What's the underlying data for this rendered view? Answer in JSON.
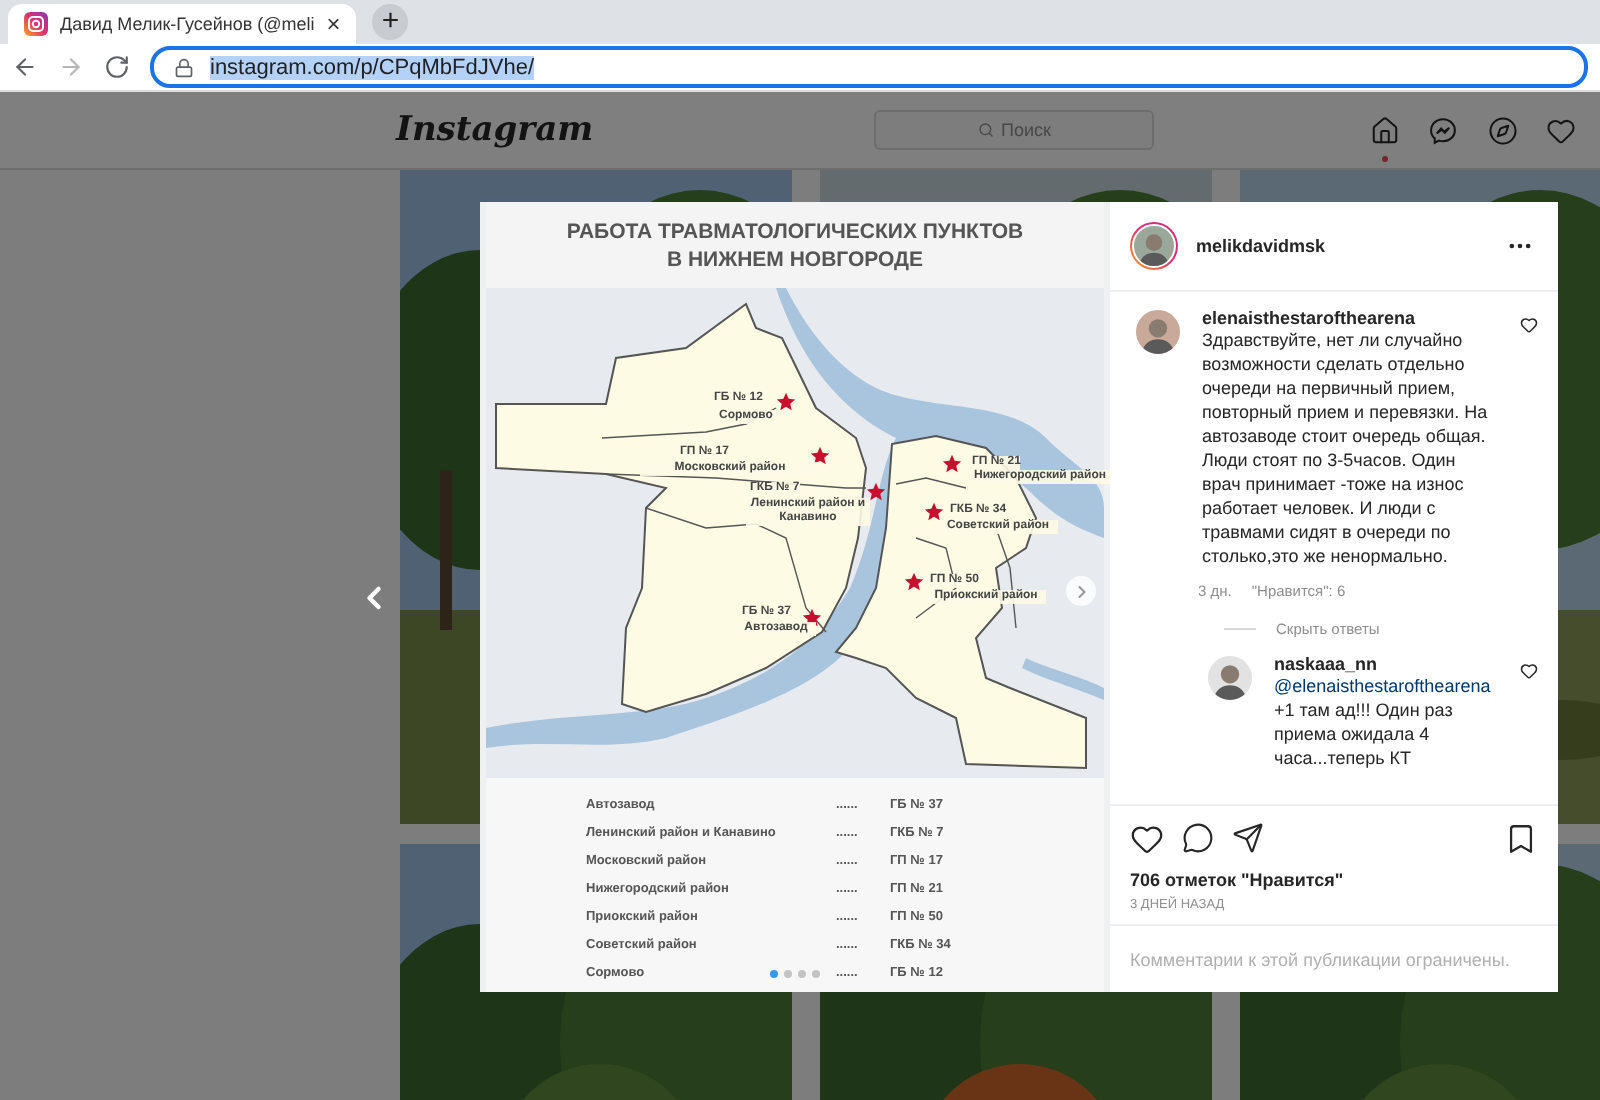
{
  "browser": {
    "tab": {
      "title": "Давид Мелик-Гусейнов (@meli",
      "close": "×"
    },
    "new_tab": "+",
    "nav": [
      {
        "kind": "back",
        "disabled": false
      },
      {
        "kind": "forward",
        "disabled": true
      },
      {
        "kind": "reload",
        "disabled": false
      }
    ],
    "url": {
      "text": "instagram.com/p/CPqMbFdJVhe/",
      "selected": true
    }
  },
  "header": {
    "logo": "Instagram",
    "search": {
      "placeholder": "Поиск"
    },
    "nav_icons": [
      {
        "kind": "home",
        "notification": true
      },
      {
        "kind": "messenger",
        "notification": false
      },
      {
        "kind": "explore",
        "notification": false
      },
      {
        "kind": "activity",
        "notification": false
      }
    ]
  },
  "post": {
    "image": {
      "title_lines": [
        "РАБОТА ТРАВМАТОЛОГИЧЕСКИХ ПУНКТОВ",
        "В НИЖНЕМ НОВГОРОДЕ"
      ],
      "map_labels": [
        {
          "code": "ГБ № 12",
          "district": "Сормово"
        },
        {
          "code": "ГП № 17",
          "district": "Московский район"
        },
        {
          "code": "ГКБ № 7",
          "district": "Ленинский район и Канавино"
        },
        {
          "code": "ГП № 21",
          "district": "Нижегородский район"
        },
        {
          "code": "ГКБ № 34",
          "district": "Советский район"
        },
        {
          "code": "ГП № 50",
          "district": "Приокский район"
        },
        {
          "code": "ГБ № 37",
          "district": "Автозавод"
        }
      ],
      "legend": [
        {
          "district": "Автозавод",
          "leader": "......",
          "code": "ГБ № 37"
        },
        {
          "district": "Ленинский район и Канавино",
          "leader": "......",
          "code": "ГКБ № 7"
        },
        {
          "district": "Московский район",
          "leader": "......",
          "code": "ГП № 17"
        },
        {
          "district": "Нижегородский район",
          "leader": "......",
          "code": "ГП № 21"
        },
        {
          "district": "Приокский район",
          "leader": "......",
          "code": "ГП № 50"
        },
        {
          "district": "Советский район",
          "leader": "......",
          "code": "ГКБ № 34"
        },
        {
          "district": "Сормово",
          "leader": "......",
          "code": "ГБ № 12"
        }
      ],
      "slides": [
        {
          "selected": true
        },
        {
          "selected": false
        },
        {
          "selected": false
        },
        {
          "selected": false
        }
      ]
    },
    "author": {
      "username": "melikdavidmsk"
    },
    "comments": [
      {
        "username": "elenaisthestarofthearena",
        "text": "Здравствуйте, нет ли случайно возможности сделать отдельно очереди на первичный прием, повторный прием и перевязки. На автозаводе стоит очередь общая. Люди стоят по 3-5часов. Один врач принимает -тоже на износ работает человек. И люди с травмами сидят в очереди по столько,это же ненормально.",
        "age": "3 дн.",
        "likes": "\"Нравится\": 6",
        "liked": false,
        "toggle": "Скрыть ответы",
        "replies": [
          {
            "username": "naskaaa_nn",
            "mention": "@elenaisthestarofthearena",
            "text": "+1 там ад!!! Один раз приема ожидала 4 часа...теперь КТ",
            "liked": false
          }
        ]
      }
    ],
    "liked": false,
    "saved": false,
    "likes": "706 отметок \"Нравится\"",
    "date": "3 ДНЕЙ НАЗАД",
    "notice": "Комментарии к этой публикации ограничены."
  }
}
